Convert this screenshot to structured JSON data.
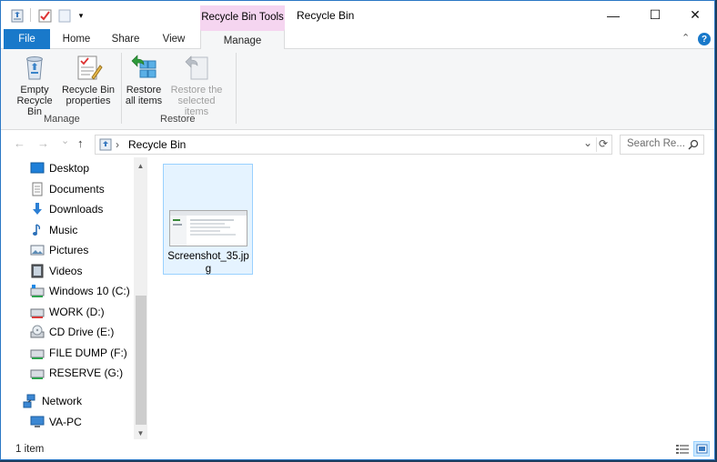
{
  "window": {
    "title": "Recycle Bin",
    "context_tab_group": "Recycle Bin Tools",
    "controls": {
      "minimize": "—",
      "maximize": "☐",
      "close": "✕"
    }
  },
  "ribbon_tabs": {
    "file": "File",
    "home": "Home",
    "share": "Share",
    "view": "View",
    "manage": "Manage",
    "collapse": "⌃",
    "help": "?"
  },
  "ribbon": {
    "manage_group": {
      "label": "Manage",
      "empty_recycle_bin": "Empty Recycle Bin",
      "recycle_bin_properties": "Recycle Bin properties"
    },
    "restore_group": {
      "label": "Restore",
      "restore_all": "Restore all items",
      "restore_selected": "Restore the selected items"
    }
  },
  "navigation": {
    "back": "←",
    "forward": "→",
    "recent": "⌄",
    "up": "↑",
    "separator": "›",
    "address": "Recycle Bin",
    "dropdown": "⌄",
    "refresh": "⟳",
    "search_placeholder": "Search Re..."
  },
  "sidebar": {
    "items": [
      {
        "label": "Desktop",
        "icon": "desktop-icon"
      },
      {
        "label": "Documents",
        "icon": "documents-icon"
      },
      {
        "label": "Downloads",
        "icon": "downloads-icon"
      },
      {
        "label": "Music",
        "icon": "music-icon"
      },
      {
        "label": "Pictures",
        "icon": "pictures-icon"
      },
      {
        "label": "Videos",
        "icon": "videos-icon"
      },
      {
        "label": "Windows 10 (C:)",
        "icon": "drive-icon"
      },
      {
        "label": "WORK (D:)",
        "icon": "drive-icon"
      },
      {
        "label": "CD Drive (E:)",
        "icon": "cd-drive-icon"
      },
      {
        "label": "FILE DUMP (F:)",
        "icon": "drive-icon"
      },
      {
        "label": "RESERVE (G:)",
        "icon": "drive-icon"
      }
    ],
    "network": "Network",
    "pc": "VA-PC"
  },
  "files": [
    {
      "name": "Screenshot_35.jpg"
    }
  ],
  "status": {
    "item_count": "1 item"
  },
  "colors": {
    "accent": "#1979ca",
    "context_tab": "#f5d5f0",
    "selection": "#e5f3ff",
    "selection_border": "#99d1ff"
  }
}
